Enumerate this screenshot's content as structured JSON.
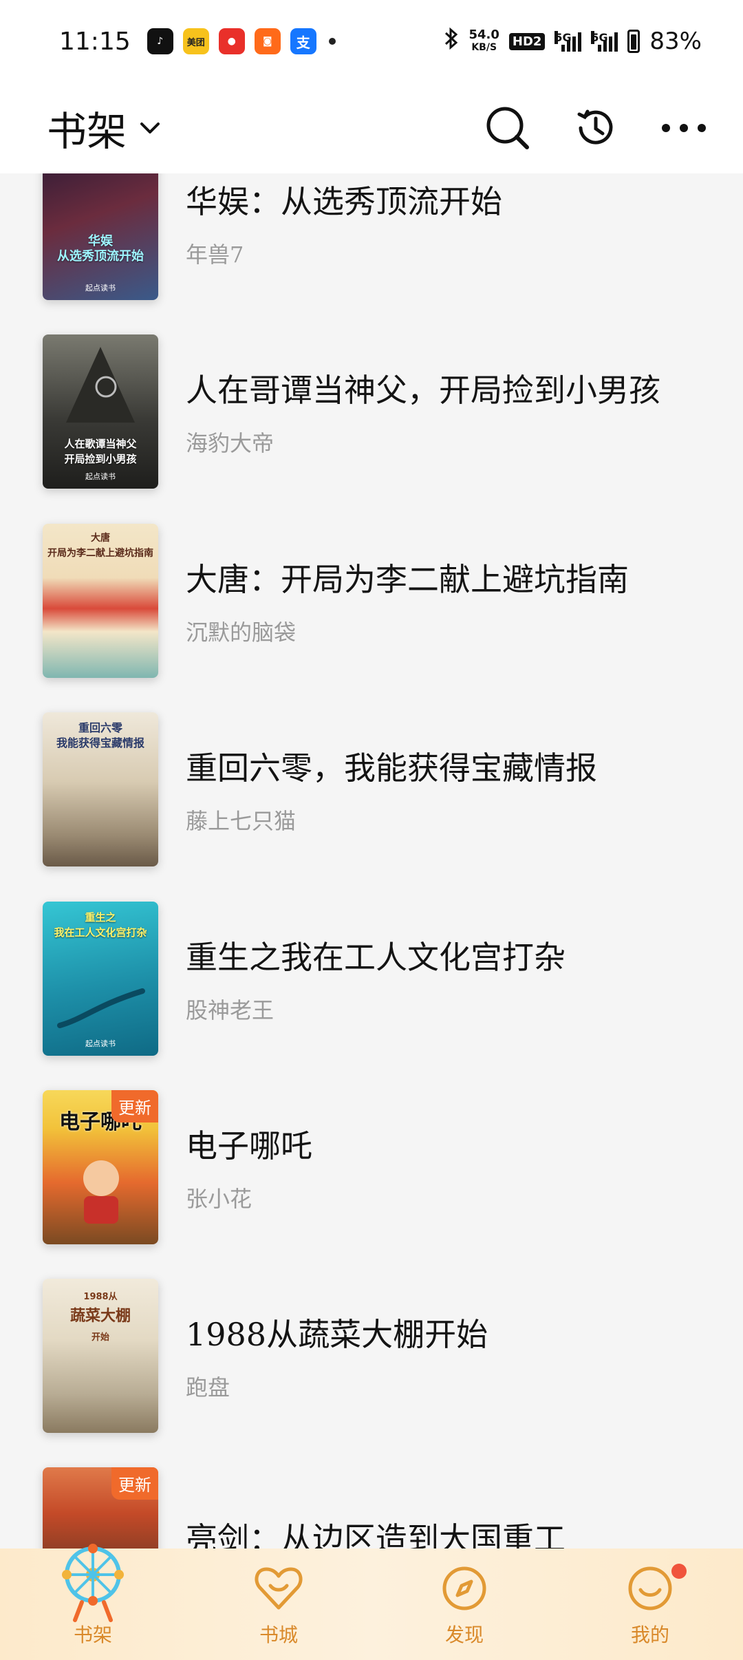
{
  "status_bar": {
    "time": "11:15",
    "apps": [
      {
        "name": "tiktok-icon",
        "label": "",
        "color": "#111111"
      },
      {
        "name": "meituan-icon",
        "label": "美团",
        "color": "#f7c21c"
      },
      {
        "name": "red-packet-icon",
        "label": "",
        "color": "#e9302a"
      },
      {
        "name": "taobao-icon",
        "label": "",
        "color": "#ff6a1a"
      },
      {
        "name": "alipay-icon",
        "label": "支",
        "color": "#1677ff"
      }
    ],
    "net_speed_value": "54.0",
    "net_speed_unit": "KB/S",
    "hd": "HD2",
    "sig1": "5G",
    "sig2": "5G",
    "battery": "83%"
  },
  "header": {
    "title": "书架"
  },
  "books": [
    {
      "title": "华娱：从选秀顶流开始",
      "author": "年兽7",
      "cover_text": "华娱\n从选秀顶流开始",
      "cover_colors": [
        "#2a1a35",
        "#6b2c3e",
        "#3a5a8a"
      ],
      "update": ""
    },
    {
      "title": "人在哥谭当神父，开局捡到小男孩",
      "author": "海豹大帝",
      "cover_text": "人在歌谭当神父\n开局捡到小男孩",
      "cover_colors": [
        "#6a6a60",
        "#3a3a36",
        "#1e1e1c"
      ],
      "update": ""
    },
    {
      "title": "大唐：开局为李二献上避坑指南",
      "author": "沉默的脑袋",
      "cover_text": "大唐\n开局为李二献上避坑指南",
      "cover_colors": [
        "#f3e6c8",
        "#d94a3a",
        "#7fb6b0"
      ],
      "update": ""
    },
    {
      "title": "重回六零，我能获得宝藏情报",
      "author": "藤上七只猫",
      "cover_text": "重回六零\n我能获得宝藏情报",
      "cover_colors": [
        "#e9e1d2",
        "#b8a78c",
        "#7a6a58"
      ],
      "update": ""
    },
    {
      "title": "重生之我在工人文化宫打杂",
      "author": "股神老王",
      "cover_text": "重生之\n我在工人文化宫打杂",
      "cover_colors": [
        "#2ab8c8",
        "#1d8fa8",
        "#0f6a85"
      ],
      "update": ""
    },
    {
      "title": "电子哪吒",
      "author": "张小花",
      "cover_text": "电子哪吒",
      "cover_colors": [
        "#f2c23a",
        "#e56a2e",
        "#7a4a22"
      ],
      "update": "更新"
    },
    {
      "title": "1988从蔬菜大棚开始",
      "author": "跑盘",
      "cover_text": "1988从\n蔬菜大棚\n开始",
      "cover_colors": [
        "#eee6d4",
        "#c9bda4",
        "#8a7a60"
      ],
      "update": ""
    },
    {
      "title": "亮剑：从边区造到大国重工",
      "author": "",
      "cover_text": "",
      "cover_colors": [
        "#c44a28",
        "#7a3a24",
        "#3a2a22"
      ],
      "update": "更新"
    }
  ],
  "bottom_nav": [
    {
      "label": "书架",
      "icon": "ferris-wheel-icon",
      "active": true
    },
    {
      "label": "书城",
      "icon": "bookstore-heart-icon",
      "active": false
    },
    {
      "label": "发现",
      "icon": "compass-icon",
      "active": false
    },
    {
      "label": "我的",
      "icon": "smile-face-icon",
      "active": false,
      "badge": true
    }
  ],
  "colors": {
    "accent": "#d9892a",
    "update_badge": "#f06a2b",
    "author_gray": "#9a9a9a"
  }
}
